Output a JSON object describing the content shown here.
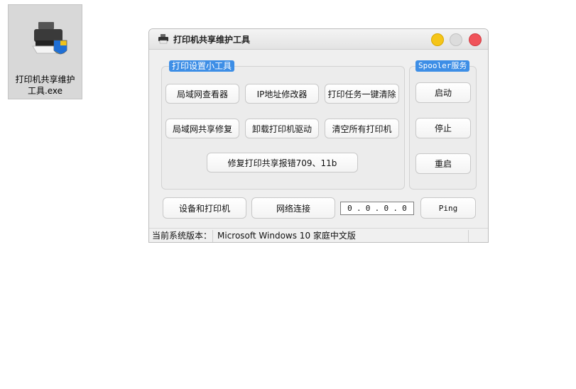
{
  "desktop": {
    "icon_label": "打印机共享维护\n工具.exe"
  },
  "window": {
    "title": "打印机共享维护工具",
    "controls": {
      "minimize": "minimize",
      "maximize": "maximize",
      "close": "close"
    },
    "colors": {
      "accent": "#3d8ee6",
      "minimize": "#f5c518",
      "maximize": "#dcdcdc",
      "close": "#f0535a"
    }
  },
  "tools": {
    "title": "打印设置小工具",
    "buttons": {
      "lan_viewer": "局域网查看器",
      "ip_changer": "IP地址修改器",
      "clear_jobs": "打印任务一键清除",
      "lan_repair": "局域网共享修复",
      "uninstall_driver": "卸载打印机驱动",
      "clear_printers": "清空所有打印机",
      "fix_errors": "修复打印共享报错709、11b"
    }
  },
  "spooler": {
    "title": "Spooler服务",
    "start": "启动",
    "stop": "停止",
    "restart": "重启"
  },
  "bottom": {
    "devices_printers": "设备和打印机",
    "network": "网络连接",
    "ip": [
      "0",
      "0",
      "0",
      "0"
    ],
    "ping": "Ping"
  },
  "status": {
    "label": "当前系统版本：",
    "value": "Microsoft Windows 10 家庭中文版"
  }
}
